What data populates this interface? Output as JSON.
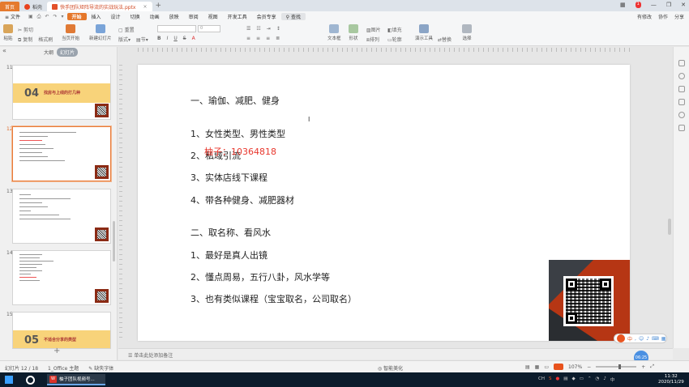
{
  "titlebar": {
    "home_tab": "首页",
    "tab2": "稻壳",
    "doc_tab": "快手团队矩阵导流的实战玩法.pptx",
    "close": "×",
    "add_tab": "+",
    "badge": "1"
  },
  "menubar": {
    "file": "文件",
    "items": [
      "开始",
      "插入",
      "设计",
      "切换",
      "动画",
      "放映",
      "审阅",
      "视图",
      "开发工具",
      "会员专享"
    ],
    "search": "查找",
    "right": [
      "有修改",
      "协作",
      "分享"
    ]
  },
  "ribbon": {
    "paste": "粘贴",
    "cut": "剪切",
    "copy": "复制",
    "format_painter": "格式刷",
    "slide_start": "当页开始",
    "new_slide": "新建幻灯片",
    "layout": "版式",
    "section": "节",
    "reset": "重置",
    "font_size_value": "0",
    "text_box": "文本框",
    "shape": "形状",
    "arrange": "排列",
    "picture": "图片",
    "fill": "填充",
    "outline": "轮廓",
    "present_tools": "演示工具",
    "replace": "替换",
    "select": "选择",
    "format_letters": [
      "B",
      "I",
      "U",
      "S"
    ]
  },
  "left_panel": {
    "outline_tab": "大纲",
    "slides_tab": "幻灯片",
    "collapse": "«",
    "add": "+",
    "thumbs": [
      {
        "num": "11",
        "big": "04",
        "title": "找房与上线的打几种",
        "selected": false
      },
      {
        "num": "12",
        "big": "",
        "title": "",
        "selected": true
      },
      {
        "num": "13",
        "big": "",
        "title": "",
        "selected": false
      },
      {
        "num": "14",
        "big": "",
        "title": "",
        "selected": false
      },
      {
        "num": "15",
        "big": "05",
        "title": "不适合分享的类型",
        "selected": false
      }
    ]
  },
  "slide": {
    "lines": [
      "一、瑜伽、减肥、健身",
      "1、女性类型、男性类型",
      "2、私域引流",
      "3、实体店线下课程",
      "4、带各种健身、减肥器材",
      "二、取名称、看风水",
      "1、最好是真人出镜",
      "2、懂点周易，五行八卦，风水学等",
      "3、也有类似课程（宝宝取名，公司取名）"
    ],
    "watermark": "柚子：10364818"
  },
  "notes": {
    "placeholder": "单击此处添加备注"
  },
  "ime": {
    "label": "中"
  },
  "timer": "06:25",
  "statusbar": {
    "slide_info": "幻灯片 12 / 18",
    "theme": "1_Office 主题",
    "font_missing": "缺失字体",
    "beautify": "智能美化",
    "zoom": "107%"
  },
  "taskbar": {
    "app_label": "柚子团队视频号..."
  },
  "tray": {
    "lang": "CH",
    "time": "11:32",
    "date": "2020/11/29"
  }
}
